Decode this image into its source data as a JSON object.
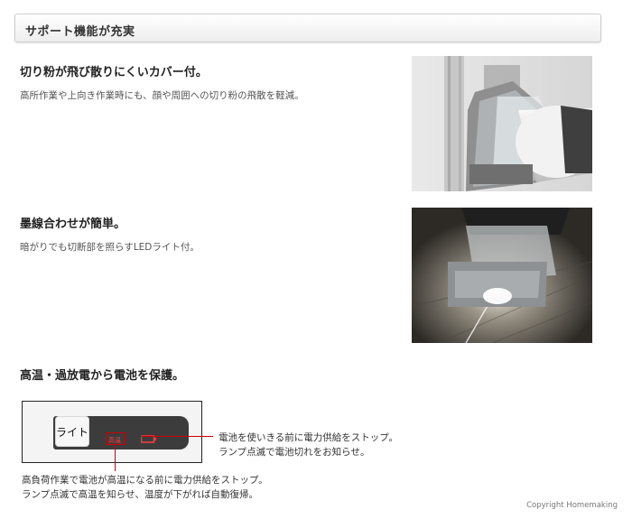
{
  "header": {
    "title": "サポート機能が充実"
  },
  "features": [
    {
      "title": "切り粉が飛び散りにくいカバー付。",
      "description": "高所作業や上向き作業時にも、顔や周囲への切り粉の飛散を軽減。"
    },
    {
      "title": "墨線合わせが簡単。",
      "description": "暗がりでも切断部を照らすLEDライト付。"
    },
    {
      "title": "高温・過放電から電池を保護。",
      "panel": {
        "light_button_label": "ライト",
        "indicator_label": "高温"
      },
      "callouts": {
        "right_line1": "電池を使いきる前に電力供給をストップ。",
        "right_line2": "ランプ点滅で電池切れをお知らせ。",
        "bottom_line1": "高負荷作業で電池が高温になる前に電力供給をストップ。",
        "bottom_line2": "ランプ点滅で高温を知らせ、温度が下がれば自動復帰。"
      }
    }
  ],
  "copyright": "Copyright Homemaking",
  "colors": {
    "callout_red": "#d00000",
    "indicator_text": "#ff3b3b",
    "panel_dark": "#3c3c3c"
  }
}
